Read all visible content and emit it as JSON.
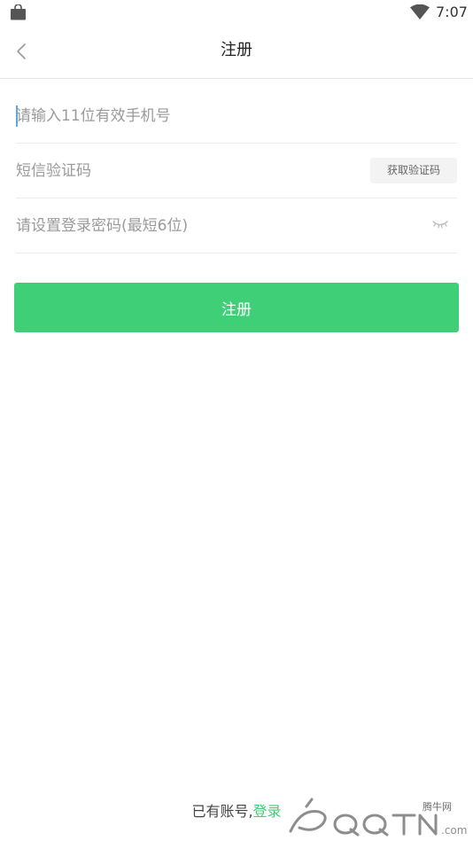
{
  "status_bar": {
    "time": "7:07",
    "icons": [
      "shopping-bag-icon",
      "wifi-icon"
    ]
  },
  "header": {
    "title": "注册",
    "back_icon": "chevron-left-icon"
  },
  "form": {
    "phone": {
      "placeholder": "请输入11位有效手机号",
      "value": ""
    },
    "code": {
      "placeholder": "短信验证码",
      "value": "",
      "get_code_label": "获取验证码"
    },
    "password": {
      "placeholder": "请设置登录密码(最短6位)",
      "value": "",
      "toggle_icon": "eye-closed-icon"
    }
  },
  "submit_label": "注册",
  "footer": {
    "prompt": "已有账号,",
    "login_link": "登录"
  },
  "watermark": {
    "cn": "腾牛网",
    "domain": ".com"
  },
  "colors": {
    "accent": "#3ecf77",
    "divider": "#ececec",
    "placeholder": "#9a9a9a",
    "caret": "#5aa9d6"
  }
}
